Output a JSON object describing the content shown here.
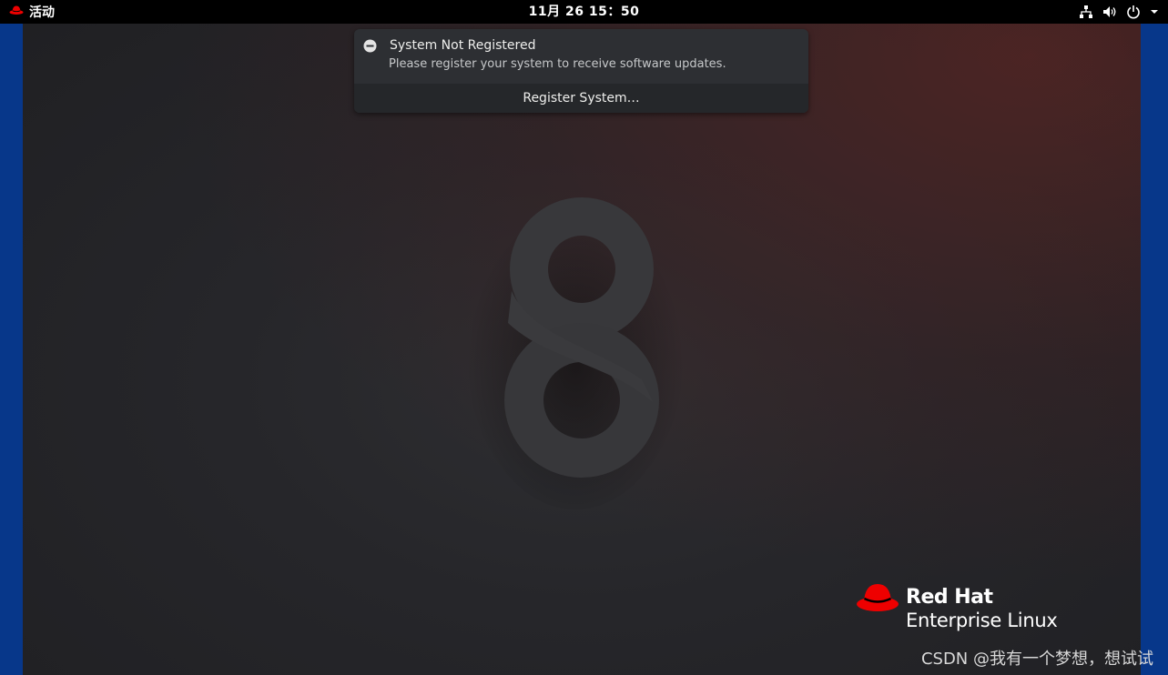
{
  "topbar": {
    "activities_label": "活动",
    "clock": "11月 26  15：50"
  },
  "tray": {
    "icons": [
      "network-icon",
      "volume-icon",
      "power-icon",
      "dropdown-arrow-icon"
    ]
  },
  "notification": {
    "title": "System Not Registered",
    "body": "Please register your system to receive software updates.",
    "action_label": "Register System…"
  },
  "desktop": {
    "version_numeral": "8"
  },
  "logo": {
    "brand": "Red Hat",
    "product": "Enterprise Linux"
  },
  "watermark": "CSDN @我有一个梦想，想试试",
  "colors": {
    "topbar": "#000000",
    "brand_red": "#ee0000",
    "notification_bg": "#2d2f33",
    "side_blue": "#07378a"
  }
}
